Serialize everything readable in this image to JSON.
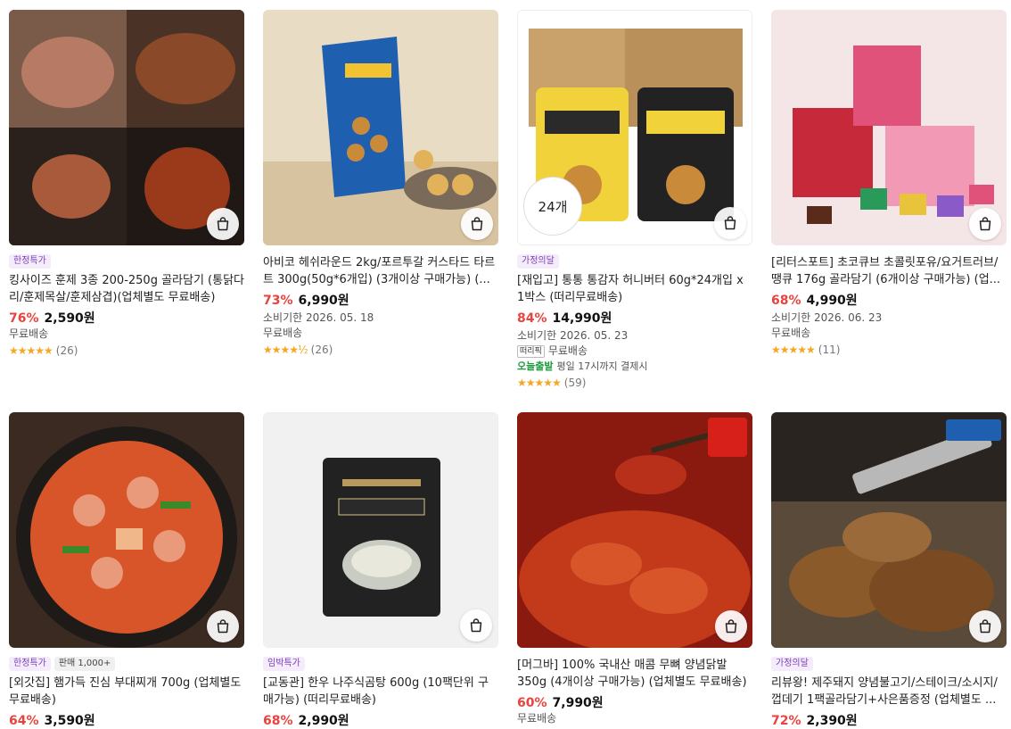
{
  "products": [
    {
      "title": "킹사이즈 훈제 3종 200-250g 골라담기 (통닭다리/훈제목살/훈제삼겹)(업체별도 무료배송)",
      "badges": [
        "한정특가"
      ],
      "discount": "76%",
      "price": "2,590원",
      "expiry": "",
      "shipping": "무료배송",
      "rating_count": "(26)",
      "stars": "★★★★★",
      "image_colors": [
        "#6b4a3a",
        "#3b2a22"
      ]
    },
    {
      "title": "아비코 헤쉬라운드 2kg/포르투갈 커스타드 타르트 300g(50g*6개입) (3개이상 구매가능) (...",
      "badges": [],
      "discount": "73%",
      "price": "6,990원",
      "expiry": "소비기한 2026. 05. 18",
      "shipping": "무료배송",
      "rating_count": "(26)",
      "stars": "★★★★½",
      "image_colors": [
        "#e9dcc5",
        "#c28a3c"
      ]
    },
    {
      "title": "[재입고] 통통 통감자 허니버터 60g*24개입 x 1박스 (떠리무료배송)",
      "badges": [
        "가정의달"
      ],
      "discount": "84%",
      "price": "14,990원",
      "expiry": "소비기한 2026. 05. 23",
      "shipping": "무료배송",
      "shipping_tag": "떠리픽",
      "today_label": "오늘출발",
      "today_text": "평일 17시까지 결제시",
      "count_badge": "24개",
      "rating_count": "(59)",
      "stars": "★★★★★",
      "image_colors": [
        "#c8a16b",
        "#f2d23a"
      ]
    },
    {
      "title": "[리터스포트] 초코큐브 초콜릿포유/요거트러브/땡큐 176g 골라담기 (6개이상 구매가능) (업...",
      "badges": [],
      "discount": "68%",
      "price": "4,990원",
      "expiry": "소비기한 2026. 06. 23",
      "shipping": "무료배송",
      "rating_count": "(11)",
      "stars": "★★★★★",
      "image_colors": [
        "#f4e6e6",
        "#e0527a"
      ]
    },
    {
      "title": "[외갓집] 햄가득 진심 부대찌개 700g (업체별도 무료배송)",
      "badges": [
        "한정특가",
        "판매 1,000+"
      ],
      "discount": "64%",
      "price": "3,590원",
      "image_colors": [
        "#d8552a",
        "#3a2a22"
      ]
    },
    {
      "title": "[교동관] 한우 나주식곰탕 600g (10팩단위 구매가능) (떠리무료배송)",
      "badges": [
        "임박특가"
      ],
      "discount": "68%",
      "price": "2,990원",
      "image_colors": [
        "#f1f1f1",
        "#222222"
      ]
    },
    {
      "title": "[머그바] 100% 국내산 매콤 무뼈 양념닭발 350g (4개이상 구매가능) (업체별도 무료배송)",
      "badges": [],
      "discount": "60%",
      "price": "7,990원",
      "shipping": "무료배송",
      "image_colors": [
        "#c23a1a",
        "#8a1a10"
      ]
    },
    {
      "title": "리뷰왕! 제주돼지 양념불고기/스테이크/소시지/껍데기 1팩골라담기+사은품증정 (업체별도 ...",
      "badges": [
        "가정의달"
      ],
      "discount": "72%",
      "price": "2,390원",
      "image_colors": [
        "#5a4a3a",
        "#2a2420"
      ]
    }
  ],
  "icons": {
    "cart": "shopping-bag-icon",
    "star": "star-icon"
  },
  "colors": {
    "discount": "#e8433e",
    "star": "#f5a623",
    "promo_badge": "#7b3fb5",
    "today": "#1a9b3a"
  }
}
